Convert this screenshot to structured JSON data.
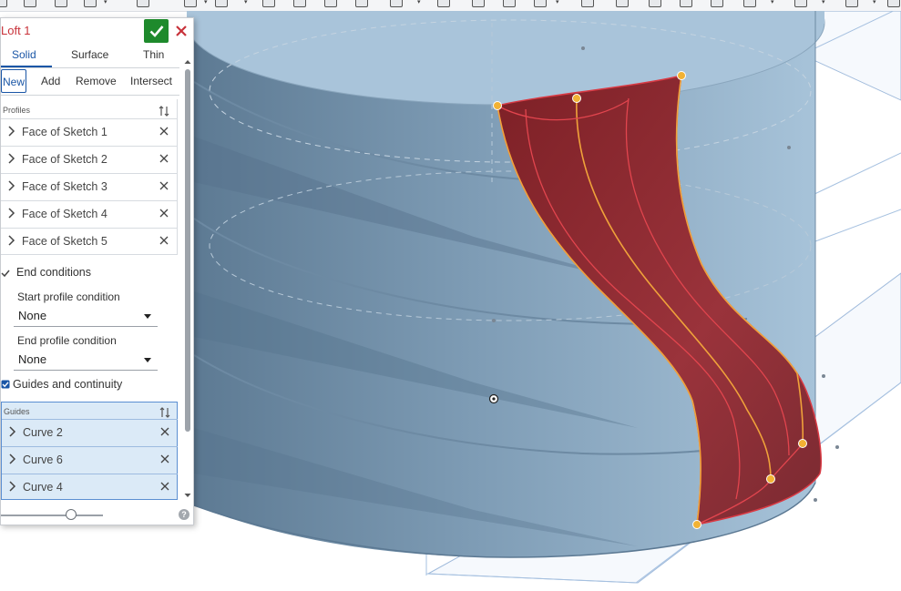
{
  "toolbar": {
    "icons": [
      "sketch-icon",
      "extrude-icon",
      "revolve-icon",
      "sweep-icon",
      "loft-icon",
      "fillet-icon",
      "chamfer-icon",
      "shell-icon",
      "draft-icon",
      "hole-icon",
      "boolean-icon",
      "split-icon",
      "transform-icon",
      "pattern-icon",
      "mirror-icon",
      "mate-connector-icon",
      "plane-icon",
      "helix-icon",
      "delete-part-icon",
      "curve-icon"
    ]
  },
  "panel": {
    "title": "Loft 1",
    "confirm_icon": "check-icon",
    "cancel_icon": "close-icon",
    "type_tabs": [
      "Solid",
      "Surface",
      "Thin"
    ],
    "type_active": "Solid",
    "op_tabs": [
      "New",
      "Add",
      "Remove",
      "Intersect"
    ],
    "op_active": "New",
    "profiles_label": "Profiles",
    "profiles": [
      "Face of Sketch 1",
      "Face of Sketch 2",
      "Face of Sketch 3",
      "Face of Sketch 4",
      "Face of Sketch 5"
    ],
    "end_conditions_label": "End conditions",
    "start_condition_label": "Start profile condition",
    "start_condition_value": "None",
    "end_condition_label": "End profile condition",
    "end_condition_value": "None",
    "guides_checkbox_label": "Guides and continuity",
    "guides_checked": true,
    "guides_label": "Guides",
    "guides": [
      "Curve 2",
      "Curve 6",
      "Curve 4"
    ],
    "slider_value": 0.68
  },
  "colors": {
    "title_red": "#c8323a",
    "confirm_green": "#1e8a2c",
    "tab_blue": "#1a56a6",
    "cylinder_blue": "#8daec9",
    "loft_red": "#8e2a31",
    "vertex_yellow": "#f2b234"
  }
}
